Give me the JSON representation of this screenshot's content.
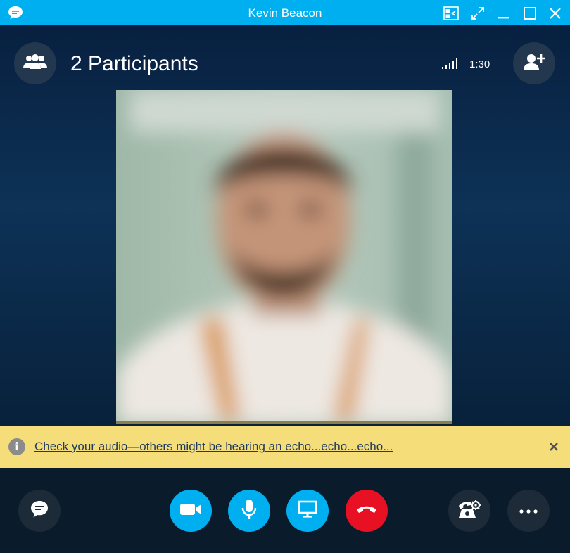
{
  "window": {
    "title": "Kevin Beacon"
  },
  "call": {
    "participants_label": "2 Participants",
    "duration": "1:30"
  },
  "notice": {
    "message": "Check your audio—others might be hearing an echo...echo...echo...",
    "close_glyph": "✕",
    "info_glyph": "i"
  },
  "colors": {
    "accent": "#00aff0",
    "hangup": "#e81123",
    "notice_bg": "#f5de7a"
  },
  "icons": {
    "titlebar": [
      "chat-bubble-icon",
      "compact-view-icon",
      "fullscreen-icon",
      "minimize-icon",
      "maximize-icon",
      "close-icon"
    ],
    "controls": [
      "chat-icon",
      "video-camera-icon",
      "microphone-icon",
      "screen-share-icon",
      "hang-up-icon",
      "dialpad-icon",
      "more-options-icon"
    ]
  }
}
